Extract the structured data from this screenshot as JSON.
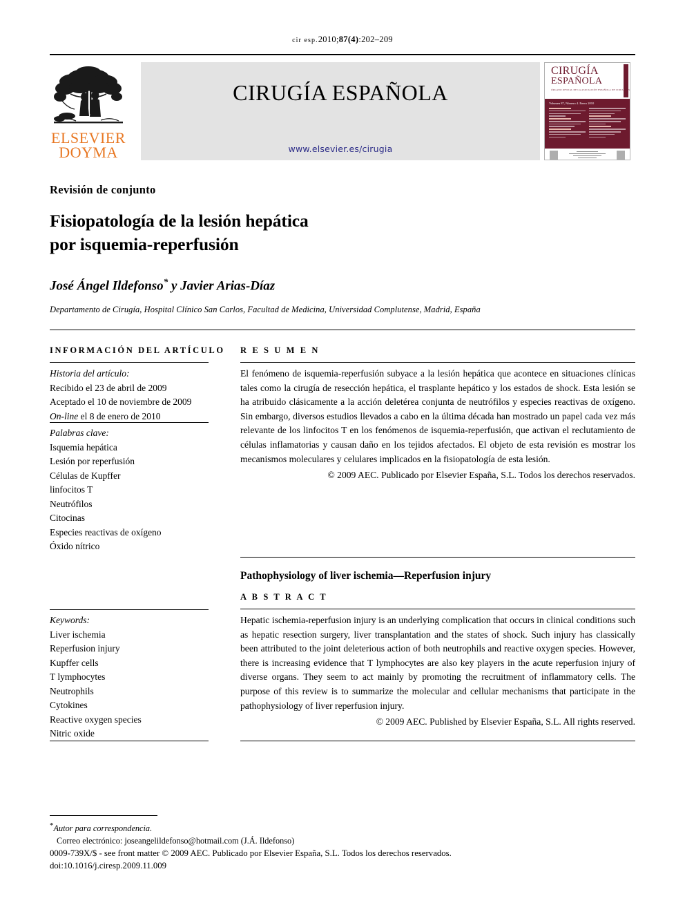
{
  "citation": {
    "journal_abbrev": "cir esp.",
    "year_volume": "2010;",
    "volume_issue": "87(4)",
    "pages": ":202–209"
  },
  "masthead": {
    "publisher_line1": "ELSEVIER",
    "publisher_line2": "DOYMA",
    "journal_title": "CIRUGÍA ESPAÑOLA",
    "journal_url": "www.elsevier.es/cirugia",
    "url_color": "#2b2b87"
  },
  "cover": {
    "title_line1": "CIRUGÍA",
    "title_line2": "ESPAÑOLA",
    "subtitle": "ÓRGANO OFICIAL DE LA ASOCIACIÓN ESPAÑOLA DE CIRUJANOS",
    "issue_line": "Volumen 87, Número 4.  Enero 2010",
    "accent_color": "#6d1a2e"
  },
  "article": {
    "section_type": "Revisión de conjunto",
    "title": "Fisiopatología de la lesión hepática por isquemia-reperfusión",
    "title_line1": "Fisiopatología de la lesión hepática",
    "title_line2": "por isquemia-reperfusión",
    "authors": "José Ángel Ildefonso",
    "author_marker": "*",
    "authors_rest": " y Javier Arias-Díaz",
    "affiliation": "Departamento de Cirugía, Hospital Clínico San Carlos, Facultad de Medicina, Universidad Complutense, Madrid, España"
  },
  "info_column": {
    "heading": "INFORMACIÓN DEL ARTÍCULO",
    "history_label": "Historia del artículo:",
    "history": [
      "Recibido el 23 de abril de 2009",
      "Aceptado el 10 de noviembre de 2009",
      "On-line el 8 de enero de 2010"
    ],
    "history_online_italic": "On-line",
    "history_online_rest": " el 8 de enero de 2010",
    "keywords_label": "Palabras clave:",
    "keywords": [
      "Isquemia hepática",
      "Lesión por reperfusión",
      "Células de Kupffer",
      "linfocitos T",
      "Neutrófilos",
      "Citocinas",
      "Especies reactivas de oxígeno",
      "Óxido nítrico"
    ],
    "keywords_en_label": "Keywords:",
    "keywords_en": [
      "Liver ischemia",
      "Reperfusion injury",
      "Kupffer cells",
      "T lymphocytes",
      "Neutrophils",
      "Cytokines",
      "Reactive oxygen species",
      "Nitric oxide"
    ]
  },
  "resumen": {
    "heading": "R E S U M E N",
    "body": "El fenómeno de isquemia-reperfusión subyace a la lesión hepática que acontece en situaciones clínicas tales como la cirugía de resección hepática, el trasplante hepático y los estados de shock. Esta lesión se ha atribuido clásicamente a la acción deletérea conjunta de neutrófilos y especies reactivas de oxígeno. Sin embargo, diversos estudios llevados a cabo en la última década han mostrado un papel cada vez más relevante de los linfocitos T en los fenómenos de isquemia-reperfusión, que activan el reclutamiento de células inflamatorias y causan daño en los tejidos afectados. El objeto de esta revisión es mostrar los mecanismos moleculares y celulares implicados en la fisiopatología de esta lesión.",
    "copyright": "© 2009 AEC. Publicado por Elsevier España, S.L. Todos los derechos reservados."
  },
  "abstract": {
    "en_title": "Pathophysiology of liver ischemia—Reperfusion injury",
    "heading": "A B S T R A C T",
    "body": "Hepatic ischemia-reperfusion injury is an underlying complication that occurs in clinical conditions such as hepatic resection surgery, liver transplantation and the states of shock. Such injury has classically been attributed to the joint deleterious action of both neutrophils and reactive oxygen species. However, there is increasing evidence that T lymphocytes are also key players in the acute reperfusion injury of diverse organs. They seem to act mainly by promoting the recruitment of inflammatory cells. The purpose of this review is to summarize the molecular and cellular mechanisms that participate in the pathophysiology of liver reperfusion injury.",
    "copyright": "© 2009 AEC. Published by Elsevier España, S.L. All rights reserved."
  },
  "footer": {
    "corresponding_label": "Autor para correspondencia.",
    "email_label": "Correo electrónico:",
    "email": "joseangelildefonso@hotmail.com",
    "email_author": "(J.Á. Ildefonso)",
    "front_matter": "0009-739X/$ - see front matter © 2009 AEC. Publicado por Elsevier España, S.L. Todos los derechos reservados.",
    "doi": "doi:10.1016/j.ciresp.2009.11.009"
  }
}
